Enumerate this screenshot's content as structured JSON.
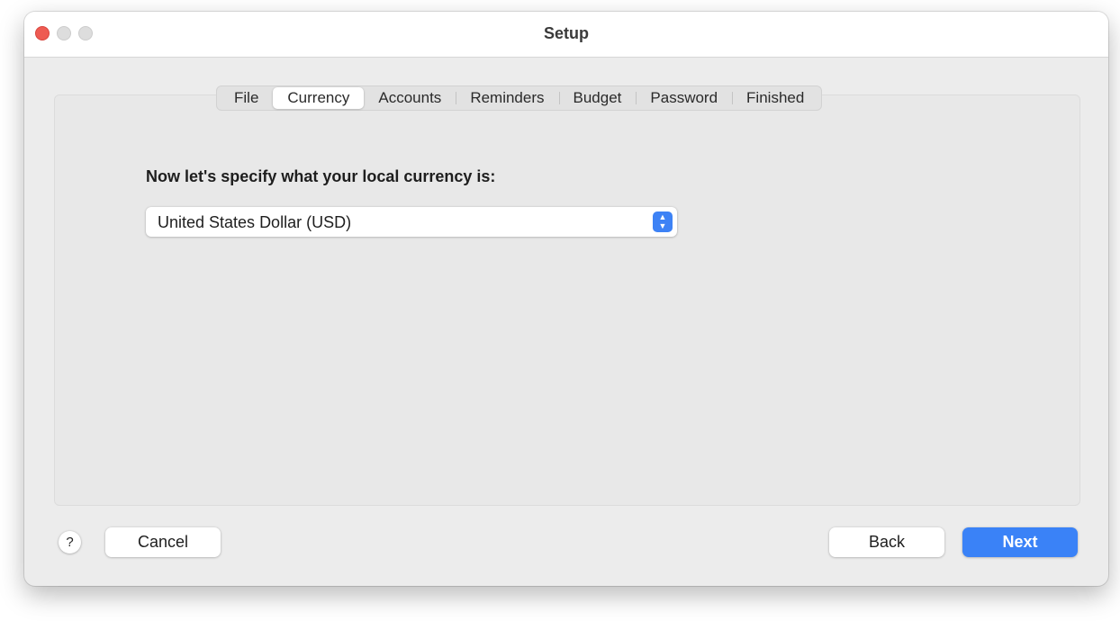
{
  "window": {
    "title": "Setup"
  },
  "tabs": [
    {
      "label": "File",
      "active": false
    },
    {
      "label": "Currency",
      "active": true
    },
    {
      "label": "Accounts",
      "active": false
    },
    {
      "label": "Reminders",
      "active": false
    },
    {
      "label": "Budget",
      "active": false
    },
    {
      "label": "Password",
      "active": false
    },
    {
      "label": "Finished",
      "active": false
    }
  ],
  "content": {
    "prompt": "Now let's specify what your local currency is:",
    "currency_select": {
      "value": "United States Dollar (USD)"
    }
  },
  "footer": {
    "help_label": "?",
    "cancel_label": "Cancel",
    "back_label": "Back",
    "next_label": "Next"
  },
  "colors": {
    "accent": "#3a82f7",
    "close_button": "#ee5b52"
  },
  "icons": {
    "popup_arrows": "chevron-up-down-icon",
    "help": "help-icon"
  }
}
